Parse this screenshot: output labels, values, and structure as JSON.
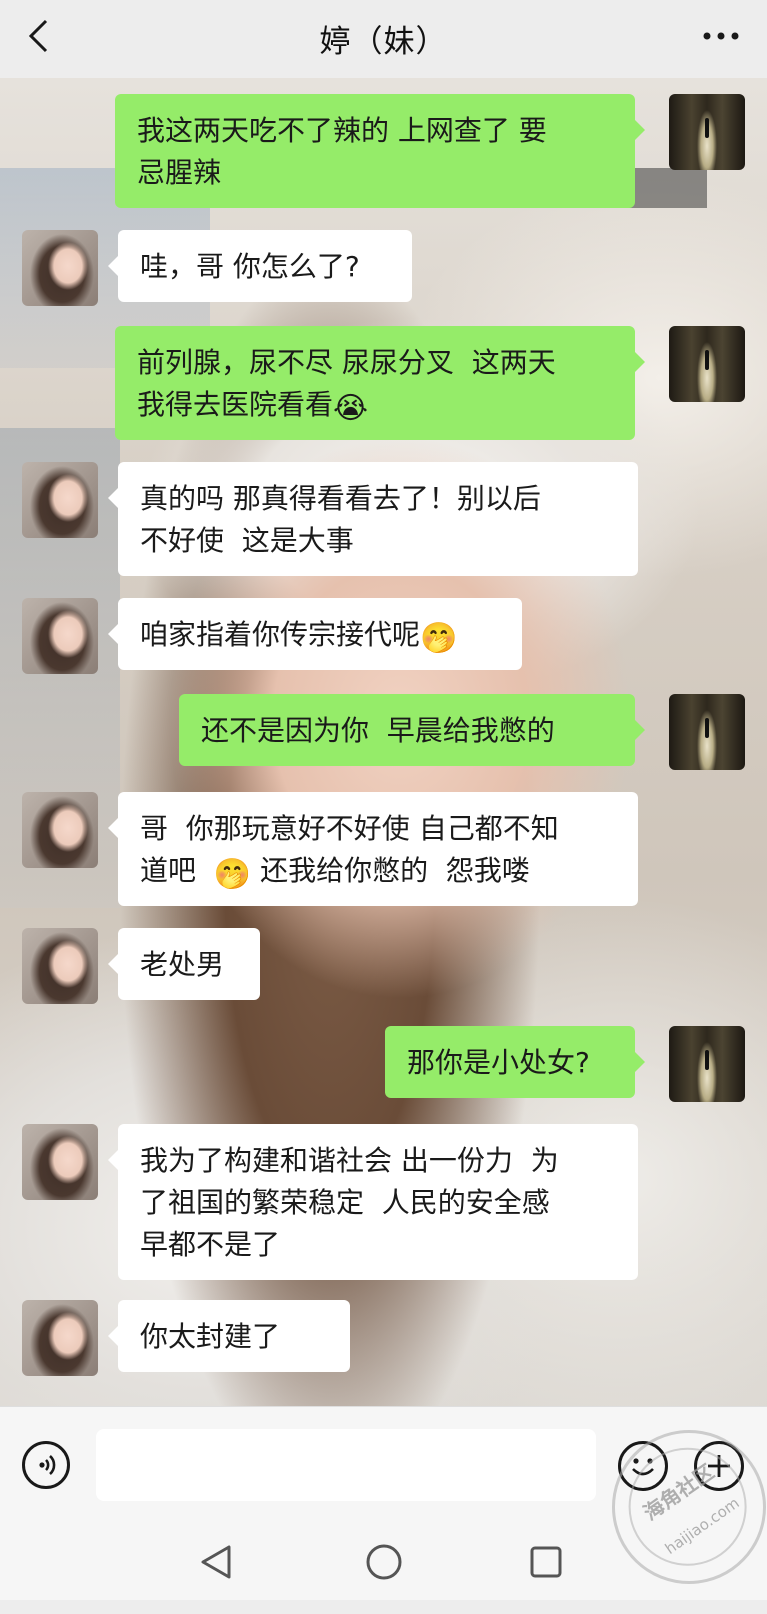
{
  "header": {
    "title": "婷（妹）"
  },
  "messages": [
    {
      "from": "me",
      "text": "我这两天吃不了辣的 上网查了 要\n忌腥辣"
    },
    {
      "from": "contact",
      "text": "哇，哥 你怎么了?"
    },
    {
      "from": "me",
      "text": "前列腺，尿不尽 尿尿分叉  这两天\n我得去医院看看",
      "emoji": "😭"
    },
    {
      "from": "contact",
      "text": "真的吗 那真得看看去了！别以后\n不好使  这是大事"
    },
    {
      "from": "contact",
      "text": "咱家指着你传宗接代呢",
      "emoji": "🤭"
    },
    {
      "from": "me",
      "text": "还不是因为你  早晨给我憋的"
    },
    {
      "from": "contact",
      "text_a": "哥  你那玩意好不好使 自己都不知\n道吧  ",
      "emoji": "🤭",
      "text_b": " 还我给你憋的  怨我喽"
    },
    {
      "from": "contact",
      "text": "老处男"
    },
    {
      "from": "me",
      "text": "那你是小处女?"
    },
    {
      "from": "contact",
      "text": "我为了构建和谐社会 出一份力  为\n了祖国的繁荣稳定  人民的安全感\n早都不是了"
    },
    {
      "from": "contact",
      "text": "你太封建了"
    }
  ],
  "input": {
    "value": ""
  },
  "watermark": {
    "cn": "海角社区",
    "en": "haijiao.com"
  }
}
